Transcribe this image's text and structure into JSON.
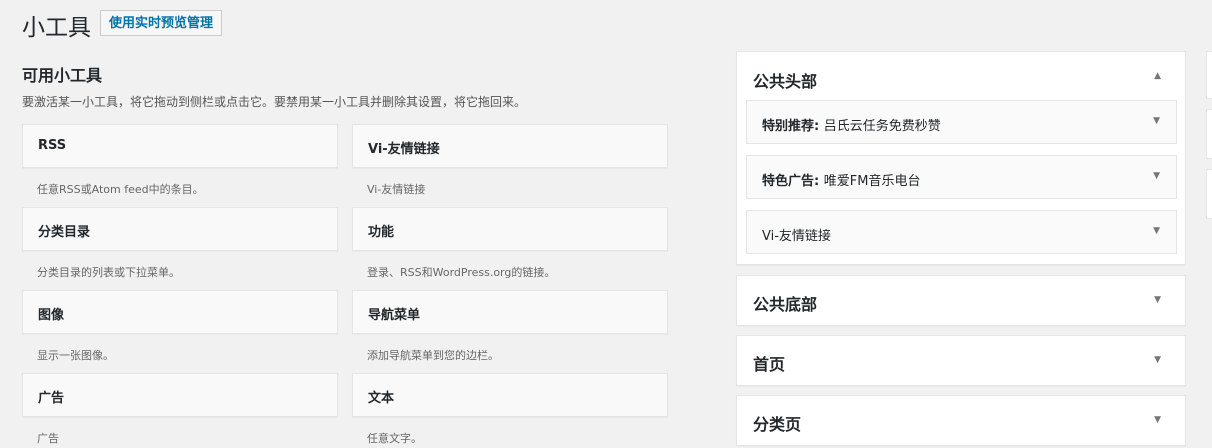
{
  "header": {
    "title": "小工具",
    "preview_button": "使用实时预览管理"
  },
  "available": {
    "title": "可用小工具",
    "description": "要激活某一小工具，将它拖动到侧栏或点击它。要禁用某一小工具并删除其设置，将它拖回来。",
    "widgets": [
      {
        "name": "RSS",
        "desc": "任意RSS或Atom feed中的条目。"
      },
      {
        "name": "Vi-友情链接",
        "desc": "Vi-友情链接"
      },
      {
        "name": "分类目录",
        "desc": "分类目录的列表或下拉菜单。"
      },
      {
        "name": "功能",
        "desc": "登录、RSS和WordPress.org的链接。"
      },
      {
        "name": "图像",
        "desc": "显示一张图像。"
      },
      {
        "name": "导航菜单",
        "desc": "添加导航菜单到您的边栏。"
      },
      {
        "name": "广告",
        "desc": "广告"
      },
      {
        "name": "文本",
        "desc": "任意文字。"
      }
    ]
  },
  "sidebars": [
    {
      "title": "公共头部",
      "expanded": true,
      "widgets": [
        {
          "label": "特别推荐",
          "sep": ": ",
          "title": "吕氏云任务免费秒赞"
        },
        {
          "label": "特色广告",
          "sep": ": ",
          "title": "唯爱FM音乐电台"
        },
        {
          "label": "Vi-友情链接",
          "sep": "",
          "title": ""
        }
      ]
    },
    {
      "title": "公共底部",
      "expanded": false
    },
    {
      "title": "首页",
      "expanded": false
    },
    {
      "title": "分类页",
      "expanded": false
    }
  ],
  "icons": {
    "expanded": "arrow-up-icon",
    "collapsed": "arrow-down-icon"
  }
}
